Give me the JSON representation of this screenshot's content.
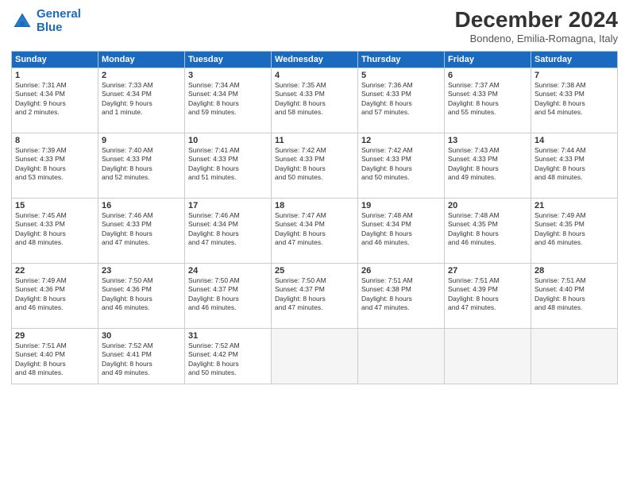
{
  "logo": {
    "line1": "General",
    "line2": "Blue"
  },
  "title": "December 2024",
  "subtitle": "Bondeno, Emilia-Romagna, Italy",
  "weekdays": [
    "Sunday",
    "Monday",
    "Tuesday",
    "Wednesday",
    "Thursday",
    "Friday",
    "Saturday"
  ],
  "weeks": [
    [
      {
        "day": "1",
        "sunrise": "Sunrise: 7:31 AM",
        "sunset": "Sunset: 4:34 PM",
        "daylight": "Daylight: 9 hours and 2 minutes."
      },
      {
        "day": "2",
        "sunrise": "Sunrise: 7:33 AM",
        "sunset": "Sunset: 4:34 PM",
        "daylight": "Daylight: 9 hours and 1 minute."
      },
      {
        "day": "3",
        "sunrise": "Sunrise: 7:34 AM",
        "sunset": "Sunset: 4:34 PM",
        "daylight": "Daylight: 8 hours and 59 minutes."
      },
      {
        "day": "4",
        "sunrise": "Sunrise: 7:35 AM",
        "sunset": "Sunset: 4:33 PM",
        "daylight": "Daylight: 8 hours and 58 minutes."
      },
      {
        "day": "5",
        "sunrise": "Sunrise: 7:36 AM",
        "sunset": "Sunset: 4:33 PM",
        "daylight": "Daylight: 8 hours and 57 minutes."
      },
      {
        "day": "6",
        "sunrise": "Sunrise: 7:37 AM",
        "sunset": "Sunset: 4:33 PM",
        "daylight": "Daylight: 8 hours and 55 minutes."
      },
      {
        "day": "7",
        "sunrise": "Sunrise: 7:38 AM",
        "sunset": "Sunset: 4:33 PM",
        "daylight": "Daylight: 8 hours and 54 minutes."
      }
    ],
    [
      {
        "day": "8",
        "sunrise": "Sunrise: 7:39 AM",
        "sunset": "Sunset: 4:33 PM",
        "daylight": "Daylight: 8 hours and 53 minutes."
      },
      {
        "day": "9",
        "sunrise": "Sunrise: 7:40 AM",
        "sunset": "Sunset: 4:33 PM",
        "daylight": "Daylight: 8 hours and 52 minutes."
      },
      {
        "day": "10",
        "sunrise": "Sunrise: 7:41 AM",
        "sunset": "Sunset: 4:33 PM",
        "daylight": "Daylight: 8 hours and 51 minutes."
      },
      {
        "day": "11",
        "sunrise": "Sunrise: 7:42 AM",
        "sunset": "Sunset: 4:33 PM",
        "daylight": "Daylight: 8 hours and 50 minutes."
      },
      {
        "day": "12",
        "sunrise": "Sunrise: 7:42 AM",
        "sunset": "Sunset: 4:33 PM",
        "daylight": "Daylight: 8 hours and 50 minutes."
      },
      {
        "day": "13",
        "sunrise": "Sunrise: 7:43 AM",
        "sunset": "Sunset: 4:33 PM",
        "daylight": "Daylight: 8 hours and 49 minutes."
      },
      {
        "day": "14",
        "sunrise": "Sunrise: 7:44 AM",
        "sunset": "Sunset: 4:33 PM",
        "daylight": "Daylight: 8 hours and 48 minutes."
      }
    ],
    [
      {
        "day": "15",
        "sunrise": "Sunrise: 7:45 AM",
        "sunset": "Sunset: 4:33 PM",
        "daylight": "Daylight: 8 hours and 48 minutes."
      },
      {
        "day": "16",
        "sunrise": "Sunrise: 7:46 AM",
        "sunset": "Sunset: 4:33 PM",
        "daylight": "Daylight: 8 hours and 47 minutes."
      },
      {
        "day": "17",
        "sunrise": "Sunrise: 7:46 AM",
        "sunset": "Sunset: 4:34 PM",
        "daylight": "Daylight: 8 hours and 47 minutes."
      },
      {
        "day": "18",
        "sunrise": "Sunrise: 7:47 AM",
        "sunset": "Sunset: 4:34 PM",
        "daylight": "Daylight: 8 hours and 47 minutes."
      },
      {
        "day": "19",
        "sunrise": "Sunrise: 7:48 AM",
        "sunset": "Sunset: 4:34 PM",
        "daylight": "Daylight: 8 hours and 46 minutes."
      },
      {
        "day": "20",
        "sunrise": "Sunrise: 7:48 AM",
        "sunset": "Sunset: 4:35 PM",
        "daylight": "Daylight: 8 hours and 46 minutes."
      },
      {
        "day": "21",
        "sunrise": "Sunrise: 7:49 AM",
        "sunset": "Sunset: 4:35 PM",
        "daylight": "Daylight: 8 hours and 46 minutes."
      }
    ],
    [
      {
        "day": "22",
        "sunrise": "Sunrise: 7:49 AM",
        "sunset": "Sunset: 4:36 PM",
        "daylight": "Daylight: 8 hours and 46 minutes."
      },
      {
        "day": "23",
        "sunrise": "Sunrise: 7:50 AM",
        "sunset": "Sunset: 4:36 PM",
        "daylight": "Daylight: 8 hours and 46 minutes."
      },
      {
        "day": "24",
        "sunrise": "Sunrise: 7:50 AM",
        "sunset": "Sunset: 4:37 PM",
        "daylight": "Daylight: 8 hours and 46 minutes."
      },
      {
        "day": "25",
        "sunrise": "Sunrise: 7:50 AM",
        "sunset": "Sunset: 4:37 PM",
        "daylight": "Daylight: 8 hours and 47 minutes."
      },
      {
        "day": "26",
        "sunrise": "Sunrise: 7:51 AM",
        "sunset": "Sunset: 4:38 PM",
        "daylight": "Daylight: 8 hours and 47 minutes."
      },
      {
        "day": "27",
        "sunrise": "Sunrise: 7:51 AM",
        "sunset": "Sunset: 4:39 PM",
        "daylight": "Daylight: 8 hours and 47 minutes."
      },
      {
        "day": "28",
        "sunrise": "Sunrise: 7:51 AM",
        "sunset": "Sunset: 4:40 PM",
        "daylight": "Daylight: 8 hours and 48 minutes."
      }
    ],
    [
      {
        "day": "29",
        "sunrise": "Sunrise: 7:51 AM",
        "sunset": "Sunset: 4:40 PM",
        "daylight": "Daylight: 8 hours and 48 minutes."
      },
      {
        "day": "30",
        "sunrise": "Sunrise: 7:52 AM",
        "sunset": "Sunset: 4:41 PM",
        "daylight": "Daylight: 8 hours and 49 minutes."
      },
      {
        "day": "31",
        "sunrise": "Sunrise: 7:52 AM",
        "sunset": "Sunset: 4:42 PM",
        "daylight": "Daylight: 8 hours and 50 minutes."
      },
      null,
      null,
      null,
      null
    ]
  ]
}
